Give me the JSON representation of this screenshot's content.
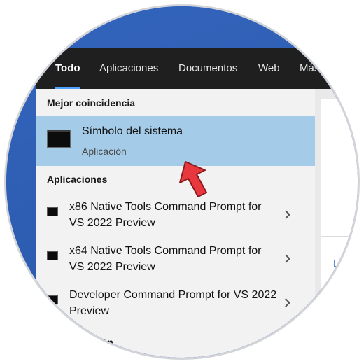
{
  "tabs": [
    {
      "label": "Todo",
      "active": true
    },
    {
      "label": "Aplicaciones"
    },
    {
      "label": "Documentos"
    },
    {
      "label": "Web"
    },
    {
      "label": "Más"
    }
  ],
  "best_match": {
    "section_title": "Mejor coincidencia",
    "title": "Símbolo del sistema",
    "subtitle": "Aplicación",
    "icon": "command-prompt-icon"
  },
  "apps": {
    "section_title": "Aplicaciones",
    "items": [
      {
        "label": "x86 Native Tools Command Prompt for VS 2022 Preview",
        "icon": "command-prompt-icon"
      },
      {
        "label": "x64 Native Tools Command Prompt for VS 2022 Preview",
        "icon": "command-prompt-icon"
      },
      {
        "label": "Developer Command Prompt for VS 2022 Preview",
        "icon": "command-prompt-icon"
      }
    ]
  },
  "next_section": {
    "title": "Configuración"
  },
  "colors": {
    "tabbar": "#1f1f1f",
    "selected_row": "#a4cbe8",
    "results_bg": "#f2f2f2",
    "accent": "#4ea3ff",
    "pointer_arrow": "#e8383d"
  }
}
